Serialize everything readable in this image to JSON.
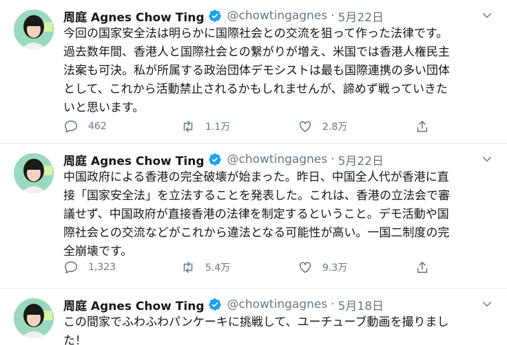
{
  "tweets": [
    {
      "name": "周庭 Agnes Chow Ting",
      "handle": "@chowtingagnes",
      "separator": "·",
      "date": "5月22日",
      "text": "今回の国家安全法は明らかに国際社会との交流を狙って作った法律です。\n過去数年間、香港人と国際社会との繋がりが増え、米国では香港人権民主\n法案も可決。私が所属する政治団体デモシストは最も国際連携の多い団体\nとして、これから活動禁止されるかもしれませんが、諦めず戦っていきた\nいと思います。",
      "replies": "462",
      "retweets": "1.1万",
      "likes": "2.8万"
    },
    {
      "name": "周庭 Agnes Chow Ting",
      "handle": "@chowtingagnes",
      "separator": "·",
      "date": "5月22日",
      "text": "中国政府による香港の完全破壊が始まった。昨日、中国全人代が香港に直\n接「国家安全法」を立法することを発表した。これは、香港の立法会で審\n議せず、中国政府が直接香港の法律を制定するということ。デモ活動や国\n際社会との交流などがこれから違法となる可能性が高い。一国二制度の完\n全崩壊です。",
      "replies": "1,323",
      "retweets": "5.4万",
      "likes": "9.3万"
    },
    {
      "name": "周庭 Agnes Chow Ting",
      "handle": "@chowtingagnes",
      "separator": "·",
      "date": "5月18日",
      "text": "この間家でふわふわパンケーキに挑戦して、ユーチューブ動画を撮りまし\nた！"
    }
  ],
  "colors": {
    "accent": "#1da1f2",
    "secondary_text": "#657786",
    "divider": "#e6ecf0"
  },
  "icons": [
    "verified-badge-icon",
    "caret-down-icon",
    "reply-icon",
    "retweet-icon",
    "like-icon",
    "share-icon"
  ]
}
